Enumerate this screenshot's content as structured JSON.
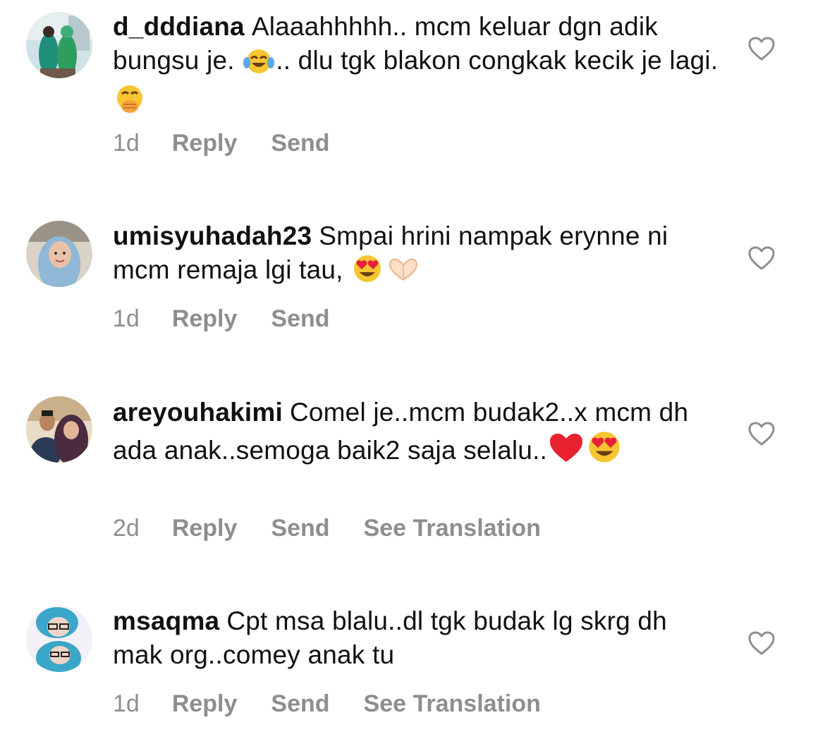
{
  "comments": [
    {
      "username": "d_dddiana",
      "text_1": "Alaaahhhhh.. mcm keluar dgn adik bungsu je. ",
      "emoji_1": "face-with-tears-of-joy",
      "text_2": ".. dlu tgk blakon congkak kecik je lagi. ",
      "emoji_2": "face-with-hand-over-mouth",
      "time": "1d",
      "reply_label": "Reply",
      "send_label": "Send",
      "like_icon": "heart-outline-icon"
    },
    {
      "username": "umisyuhadah23",
      "text_1": "Smpai hrini nampak erynne ni mcm remaja lgi tau, ",
      "emoji_1": "smiling-face-with-heart-eyes",
      "emoji_2": "heart-hands",
      "time": "1d",
      "reply_label": "Reply",
      "send_label": "Send",
      "like_icon": "heart-outline-icon"
    },
    {
      "username": "areyouhakimi",
      "text_1": "Comel je..mcm budak2..x mcm dh ada anak..semoga baik2 saja selalu..",
      "emoji_1": "red-heart",
      "emoji_2": "smiling-face-with-heart-eyes",
      "time": "2d",
      "reply_label": "Reply",
      "send_label": "Send",
      "translation_label": "See Translation",
      "like_icon": "heart-outline-icon"
    },
    {
      "username": "msaqma",
      "text_1": "Cpt msa blalu..dl tgk budak lg skrg dh mak org..comey anak tu",
      "time": "1d",
      "reply_label": "Reply",
      "send_label": "Send",
      "translation_label": "See Translation",
      "like_icon": "heart-outline-icon"
    }
  ],
  "colors": {
    "text": "#111111",
    "secondary": "#8e8e8e",
    "background": "#ffffff"
  }
}
